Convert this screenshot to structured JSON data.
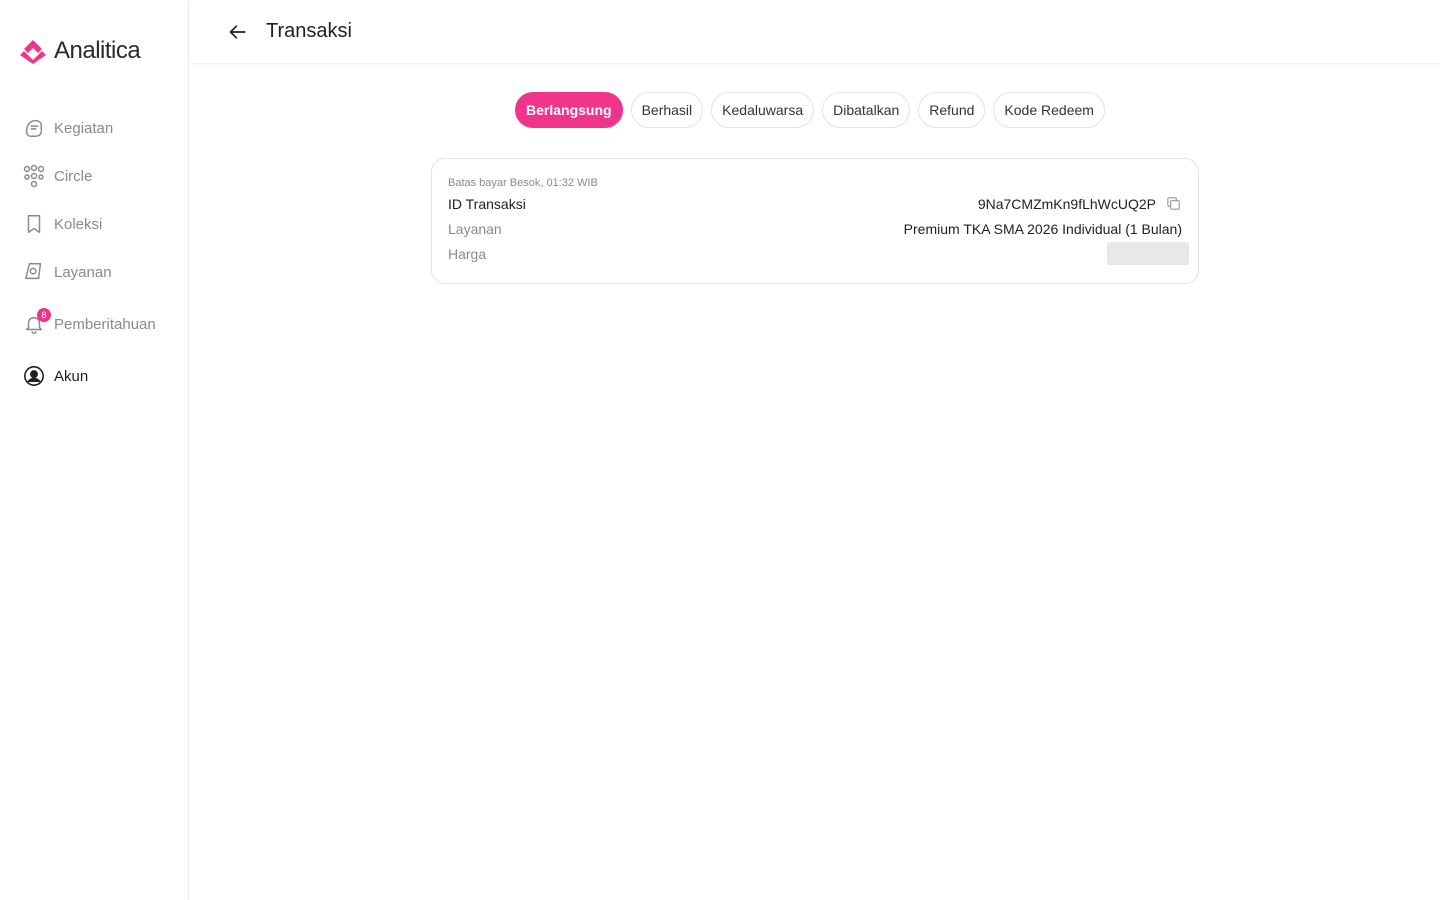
{
  "brand": {
    "name": "Analitica",
    "accent": "#f0348a"
  },
  "sidebar": {
    "items": [
      {
        "label": "Kegiatan",
        "icon": "activity-icon",
        "active": false
      },
      {
        "label": "Circle",
        "icon": "community-icon",
        "active": false
      },
      {
        "label": "Koleksi",
        "icon": "bookmark-icon",
        "active": false
      },
      {
        "label": "Layanan",
        "icon": "service-icon",
        "active": false
      },
      {
        "label": "Pemberitahuan",
        "icon": "bell-icon",
        "active": false,
        "badge": "8"
      },
      {
        "label": "Akun",
        "icon": "account-icon",
        "active": true
      }
    ]
  },
  "header": {
    "title": "Transaksi",
    "back_icon": "arrow-left-icon"
  },
  "tabs": [
    {
      "label": "Berlangsung",
      "active": true
    },
    {
      "label": "Berhasil",
      "active": false
    },
    {
      "label": "Kedaluwarsa",
      "active": false
    },
    {
      "label": "Dibatalkan",
      "active": false
    },
    {
      "label": "Refund",
      "active": false
    },
    {
      "label": "Kode Redeem",
      "active": false
    }
  ],
  "transaction": {
    "deadline": "Batas bayar Besok, 01:32 WIB",
    "id_label": "ID Transaksi",
    "id_value": "9Na7CMZmKn9fLhWcUQ2P",
    "service_label": "Layanan",
    "service_value": "Premium TKA SMA 2026 Individual (1 Bulan)",
    "price_label": "Harga"
  }
}
